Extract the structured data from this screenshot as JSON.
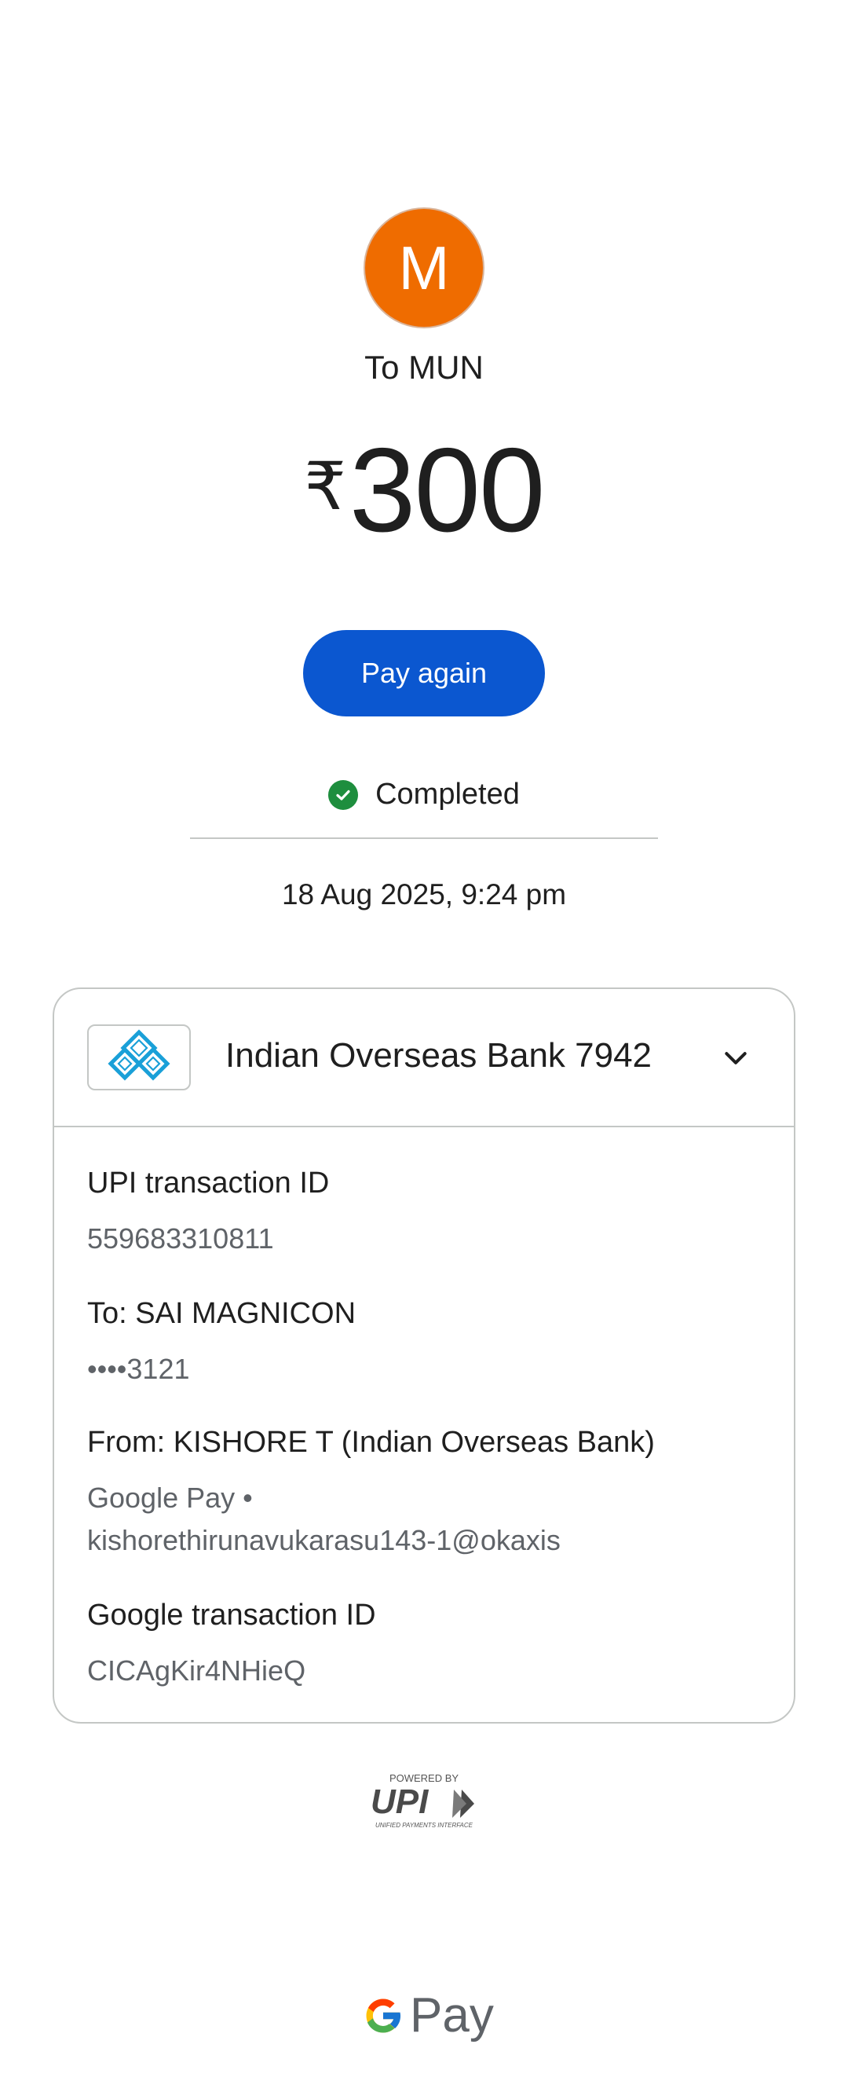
{
  "payee": {
    "initial": "M",
    "to_line": "To MUN"
  },
  "amount": {
    "currency_symbol": "₹",
    "value": "300"
  },
  "actions": {
    "pay_again_label": "Pay again"
  },
  "status": {
    "label": "Completed",
    "color": "#1e8e3e"
  },
  "datetime": "18 Aug 2025, 9:24 pm",
  "bank": {
    "name": "Indian Overseas Bank 7942"
  },
  "details": [
    {
      "label": "UPI transaction ID",
      "value": "559683310811"
    },
    {
      "label": "To: SAI MAGNICON",
      "value": "••••3121"
    },
    {
      "label": "From: KISHORE  T (Indian Overseas Bank)",
      "value_line1": "Google Pay •",
      "value_line2": "kishorethirunavukarasu143-1@okaxis"
    },
    {
      "label": "Google transaction ID",
      "value": "CICAgKir4NHieQ"
    }
  ],
  "footer": {
    "powered_by": "POWERED BY",
    "upi_mark": "UPI",
    "upi_tagline": "UNIFIED PAYMENTS INTERFACE",
    "gpay_text": "Pay"
  },
  "colors": {
    "accent": "#0b57d0",
    "avatar": "#ef6c00"
  }
}
